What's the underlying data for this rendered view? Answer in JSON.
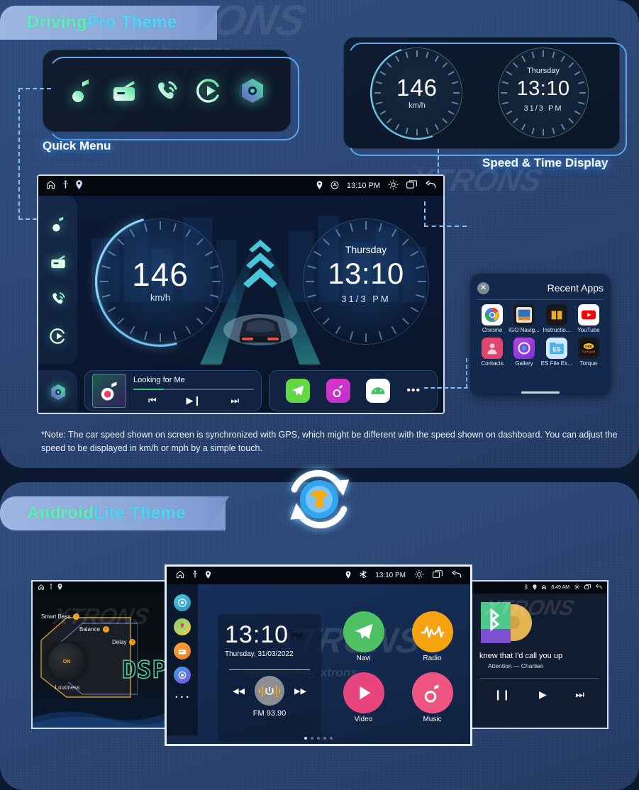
{
  "sections": {
    "driving": {
      "title_a": "Driving ",
      "title_b": "Pro Theme"
    },
    "lite": {
      "title_a": "Android ",
      "title_b": "Lite Theme"
    }
  },
  "labels": {
    "quick_menu": "Quick Menu",
    "speed_time": "Speed & Time Display"
  },
  "quick_menu": {
    "icons": [
      {
        "name": "music-icon"
      },
      {
        "name": "radio-icon"
      },
      {
        "name": "phone-icon"
      },
      {
        "name": "video-icon"
      },
      {
        "name": "settings-icon"
      }
    ]
  },
  "speed_time_card": {
    "speed": {
      "value": "146",
      "unit": "km/h"
    },
    "time": {
      "day": "Thursday",
      "time": "13:10",
      "date": "31/3",
      "ampm": "PM"
    }
  },
  "head_unit": {
    "status": {
      "home_icon": "home-icon",
      "usb_icon": "usb-icon",
      "gps_icon": "gps-icon",
      "location_icon": "location-icon",
      "wifi_icon": "wifi-icon",
      "time": "13:10 PM",
      "brightness_icon": "brightness-icon",
      "recents_icon": "recents-icon",
      "back_icon": "back-icon"
    },
    "sidebar": [
      {
        "name": "sidebar-music",
        "label": "Music"
      },
      {
        "name": "sidebar-radio",
        "label": "Radio"
      },
      {
        "name": "sidebar-phone",
        "label": "Phone"
      },
      {
        "name": "sidebar-video",
        "label": "Video"
      },
      {
        "name": "sidebar-settings",
        "label": "Settings"
      }
    ],
    "speed": {
      "value": "146",
      "unit": "km/h"
    },
    "clock": {
      "day": "Thursday",
      "time": "13:10",
      "date": "31/3",
      "ampm": "PM"
    },
    "player": {
      "song": "Looking for Me",
      "prev": "⏮",
      "play_pause": "▶❙",
      "next": "⏭"
    },
    "shortcuts": [
      {
        "name": "telegram-app-icon"
      },
      {
        "name": "music-app-icon"
      },
      {
        "name": "android-auto-app-icon"
      },
      {
        "name": "more-apps-icon",
        "label": "•••"
      }
    ]
  },
  "recent_apps": {
    "title": "Recent Apps",
    "close": "✕",
    "apps": [
      {
        "name": "Chrome",
        "icon": "chrome-icon"
      },
      {
        "name": "iGO Navig...",
        "icon": "igo-navigation-icon"
      },
      {
        "name": "Instructio...",
        "icon": "instructions-icon"
      },
      {
        "name": "YouTube",
        "icon": "youtube-icon"
      },
      {
        "name": "Contacts",
        "icon": "contacts-icon"
      },
      {
        "name": "Gallery",
        "icon": "gallery-icon"
      },
      {
        "name": "ES File Ex...",
        "icon": "es-file-explorer-icon"
      },
      {
        "name": "Torque",
        "icon": "torque-icon"
      }
    ]
  },
  "note": "*Note: The car speed shown on screen is synchronized with GPS, which might be different with the speed shown on dashboard. You can adjust the speed to be displayed in km/h or mph by a simple touch.",
  "swap_badge": {
    "name": "theme-swap-icon",
    "inner": "tshirt-icon"
  },
  "lite_center": {
    "status": {
      "time": "13:10 PM"
    },
    "rail": [
      {
        "name": "rail-settings-icon"
      },
      {
        "name": "rail-maps-icon"
      },
      {
        "name": "rail-radio-icon"
      },
      {
        "name": "rail-gallery-icon"
      },
      {
        "name": "rail-more-icon",
        "label": "• • •"
      }
    ],
    "clock": {
      "time": "13:10",
      "ampm": "PM",
      "date": "Thursday, 31/03/2022"
    },
    "radio": {
      "prev": "◀◀",
      "next": "▶▶",
      "station": "FM 93.90"
    },
    "apps": [
      {
        "label": "Navi",
        "icon": "navi-icon",
        "color": "#4ec262"
      },
      {
        "label": "Radio",
        "icon": "radio-icon",
        "color": "#f5a310"
      },
      {
        "label": "Video",
        "icon": "video-icon",
        "color": "#e8447d"
      },
      {
        "label": "Music",
        "icon": "music-icon",
        "color": "#ee5583"
      }
    ],
    "page_dots": 5,
    "active_dot": 0
  },
  "lite_left": {
    "status": {
      "home": "home-icon",
      "usb": "usb-icon",
      "gps": "gps-icon"
    },
    "chips": [
      {
        "label": "Smart Bass",
        "badge": "›"
      },
      {
        "label": "Balance",
        "badge": "›"
      },
      {
        "label": "Delay",
        "badge": "›"
      }
    ],
    "knob": {
      "state": "ON",
      "label": "Loudness"
    },
    "logo": "DSP"
  },
  "lite_right": {
    "status": {
      "time": "8:49 AM"
    },
    "track_title": "knew that I'd call you up",
    "track_sub": "Attention — Charlien",
    "controls": {
      "pause": "❙❙",
      "play": "▶",
      "next": "⏭"
    }
  },
  "watermarks": {
    "brand": "XTRONS",
    "copy": "copyright by xtrons"
  },
  "colors": {
    "banner_bg": "#8fa9da",
    "title_green": "#5bf0b6",
    "title_cyan": "#4dd7f5",
    "glow_blue": "#5ba7f0",
    "panel_bg": "#2b4877"
  }
}
